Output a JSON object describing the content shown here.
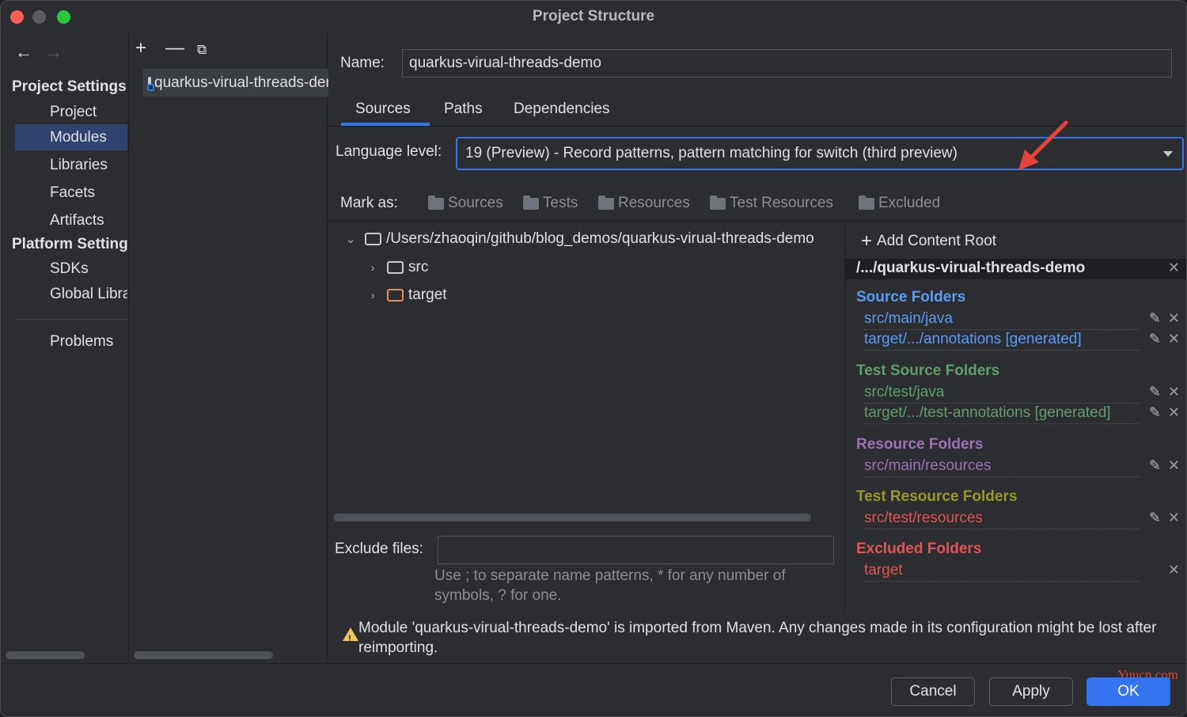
{
  "window": {
    "title": "Project Structure"
  },
  "nav": {
    "back_icon": "arrow-left-icon",
    "forward_icon": "arrow-right-icon",
    "group1": "Project Settings",
    "items1": [
      "Project",
      "Modules",
      "Libraries",
      "Facets",
      "Artifacts"
    ],
    "group2": "Platform Settings",
    "items2": [
      "SDKs",
      "Global Libraries"
    ],
    "problems": "Problems",
    "selected": "Modules"
  },
  "modules": {
    "items": [
      "quarkus-virual-threads-demo"
    ]
  },
  "main": {
    "name_label": "Name:",
    "name_value": "quarkus-virual-threads-demo",
    "tabs": [
      "Sources",
      "Paths",
      "Dependencies"
    ],
    "active_tab": "Sources",
    "lang_label": "Language level:",
    "lang_value": "19 (Preview) - Record patterns, pattern matching for switch (third preview)",
    "markas_label": "Mark as:",
    "markas": [
      "Sources",
      "Tests",
      "Resources",
      "Test Resources",
      "Excluded"
    ],
    "tree": {
      "root": "/Users/zhaoqin/github/blog_demos/quarkus-virual-threads-demo",
      "children": [
        "src",
        "target"
      ]
    },
    "exclude_label": "Exclude files:",
    "exclude_value": "",
    "hint": "Use ; to separate name patterns, * for any number of symbols, ? for one.",
    "warning": "Module 'quarkus-virual-threads-demo' is imported from Maven. Any changes made in its configuration might be lost after reimporting."
  },
  "content_root": {
    "add_label": "Add Content Root",
    "root_title": "/.../quarkus-virual-threads-demo",
    "sections": [
      {
        "title": "Source Folders",
        "color": "#5a9cf5",
        "entries": [
          "src/main/java",
          "target/.../annotations [generated]"
        ]
      },
      {
        "title": "Test Source Folders",
        "color": "#5e9f6b",
        "entries": [
          "src/test/java",
          "target/.../test-annotations [generated]"
        ]
      },
      {
        "title": "Resource Folders",
        "color": "#9b72b8",
        "entries": [
          "src/main/resources"
        ]
      },
      {
        "title": "Test Resource Folders",
        "color": "#9a9a28",
        "entries": [
          "src/test/resources"
        ]
      },
      {
        "title": "Excluded Folders",
        "color": "#e05555",
        "entries": [
          "target"
        ]
      }
    ],
    "entry_text_colors": [
      "#5a9cf5",
      "#5e9f6b",
      "#9b72b8",
      "#e05555",
      "#e05555"
    ]
  },
  "footer": {
    "cancel": "Cancel",
    "apply": "Apply",
    "ok": "OK",
    "watermark": "Yuucn.com"
  }
}
